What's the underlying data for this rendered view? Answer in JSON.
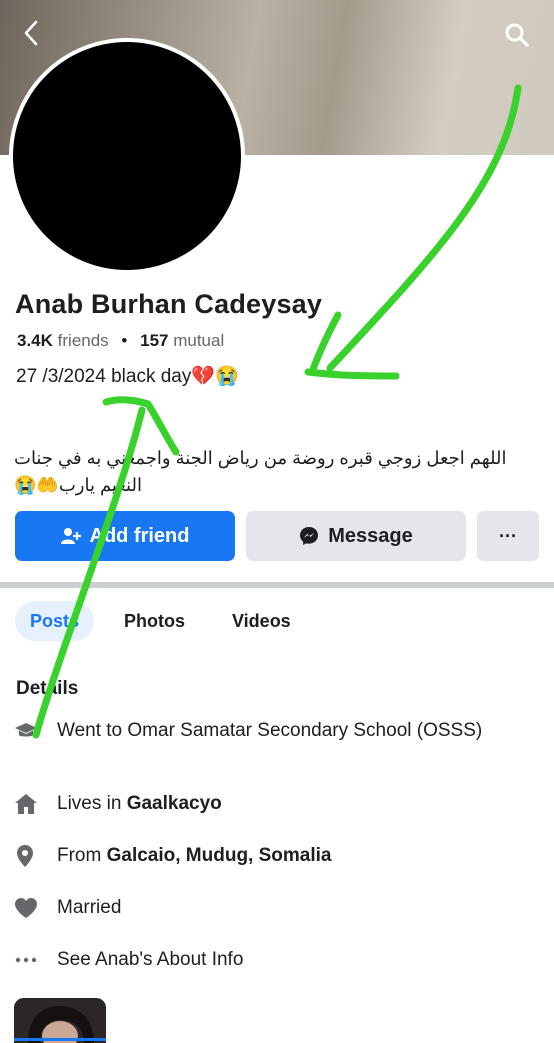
{
  "profile": {
    "name": "Anab Burhan Cadeysay",
    "friends_count": "3.4K",
    "friends_label": "friends",
    "separator": "•",
    "mutual_count": "157",
    "mutual_label": "mutual",
    "bio_line": "27 /3/2024 black day💔😭",
    "bio_arabic": "اللهم اجعل زوجي قبره روضة من رياض الجنة واجمعني به في جنات النعيم يارب🤲😭"
  },
  "actions": {
    "add_friend": "Add friend",
    "message": "Message",
    "more": "···"
  },
  "tabs": [
    {
      "label": "Posts",
      "active": true
    },
    {
      "label": "Photos",
      "active": false
    },
    {
      "label": "Videos",
      "active": false
    }
  ],
  "details": {
    "heading": "Details",
    "items": [
      {
        "icon": "school-icon",
        "prefix": "Went to Omar Samatar Secondary School (OSSS)",
        "bold": ""
      },
      {
        "icon": "home-icon",
        "prefix": "Lives in ",
        "bold": "Gaalkacyo"
      },
      {
        "icon": "location-pin-icon",
        "prefix": "From ",
        "bold": "Galcaio, Mudug, Somalia"
      },
      {
        "icon": "heart-icon",
        "prefix": "Married",
        "bold": ""
      },
      {
        "icon": "more-dots-icon",
        "prefix": "See Anab's About Info",
        "bold": ""
      }
    ]
  },
  "colors": {
    "primary": "#1877f2",
    "secondary_button": "#e4e6eb",
    "annotation": "#39d12b",
    "muted_text": "#65676b"
  }
}
